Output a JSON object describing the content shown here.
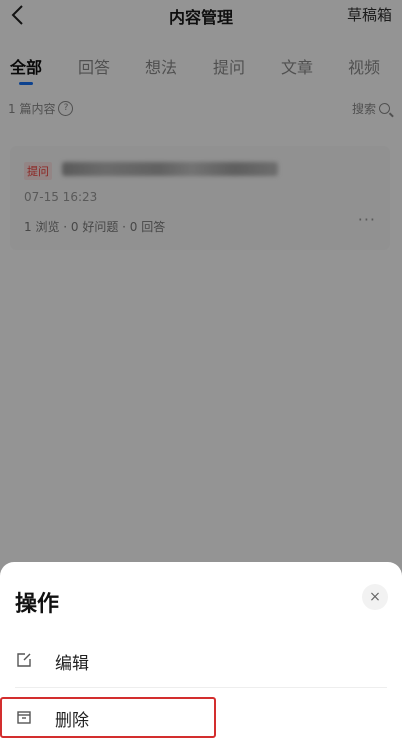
{
  "header": {
    "title": "内容管理",
    "drafts_label": "草稿箱"
  },
  "tabs": [
    {
      "label": "全部",
      "active": true
    },
    {
      "label": "回答",
      "active": false
    },
    {
      "label": "想法",
      "active": false
    },
    {
      "label": "提问",
      "active": false
    },
    {
      "label": "文章",
      "active": false
    },
    {
      "label": "视频",
      "active": false
    }
  ],
  "meta": {
    "count_label": "1 篇内容",
    "help_glyph": "?",
    "search_label": "搜索"
  },
  "card": {
    "tag": "提问",
    "date": "07-15 16:23",
    "stats": "1 浏览 · 0 好问题 · 0 回答",
    "more_glyph": "···"
  },
  "sheet": {
    "title": "操作",
    "close_glyph": "×",
    "actions": [
      {
        "label": "编辑",
        "icon": "edit-icon"
      },
      {
        "label": "删除",
        "icon": "trash-icon",
        "highlighted": true
      }
    ]
  },
  "colors": {
    "accent": "#1772f6",
    "tag_red": "#f1403c",
    "highlight_border": "#d32e2e"
  }
}
